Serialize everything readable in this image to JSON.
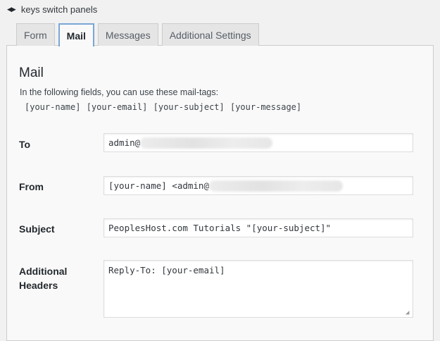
{
  "hint": {
    "arrows_icon": "left-right-arrows-icon",
    "text": "keys switch panels"
  },
  "tabs": [
    {
      "label": "Form",
      "active": false
    },
    {
      "label": "Mail",
      "active": true
    },
    {
      "label": "Messages",
      "active": false
    },
    {
      "label": "Additional Settings",
      "active": false
    }
  ],
  "panel": {
    "title": "Mail",
    "description": "In the following fields, you can use these mail-tags:",
    "mail_tags": "[your-name] [your-email] [your-subject] [your-message]"
  },
  "fields": {
    "to": {
      "label": "To",
      "value": "admin@"
    },
    "from": {
      "label": "From",
      "value": "[your-name] <admin@"
    },
    "subject": {
      "label": "Subject",
      "value": "PeoplesHost.com Tutorials \"[your-subject]\""
    },
    "headers": {
      "label_line1": "Additional",
      "label_line2": "Headers",
      "value": "Reply-To: [your-email]"
    }
  },
  "colors": {
    "active_tab_border": "#7aa6d6",
    "panel_background": "#f9f9f9",
    "page_background": "#f1f1f1"
  }
}
